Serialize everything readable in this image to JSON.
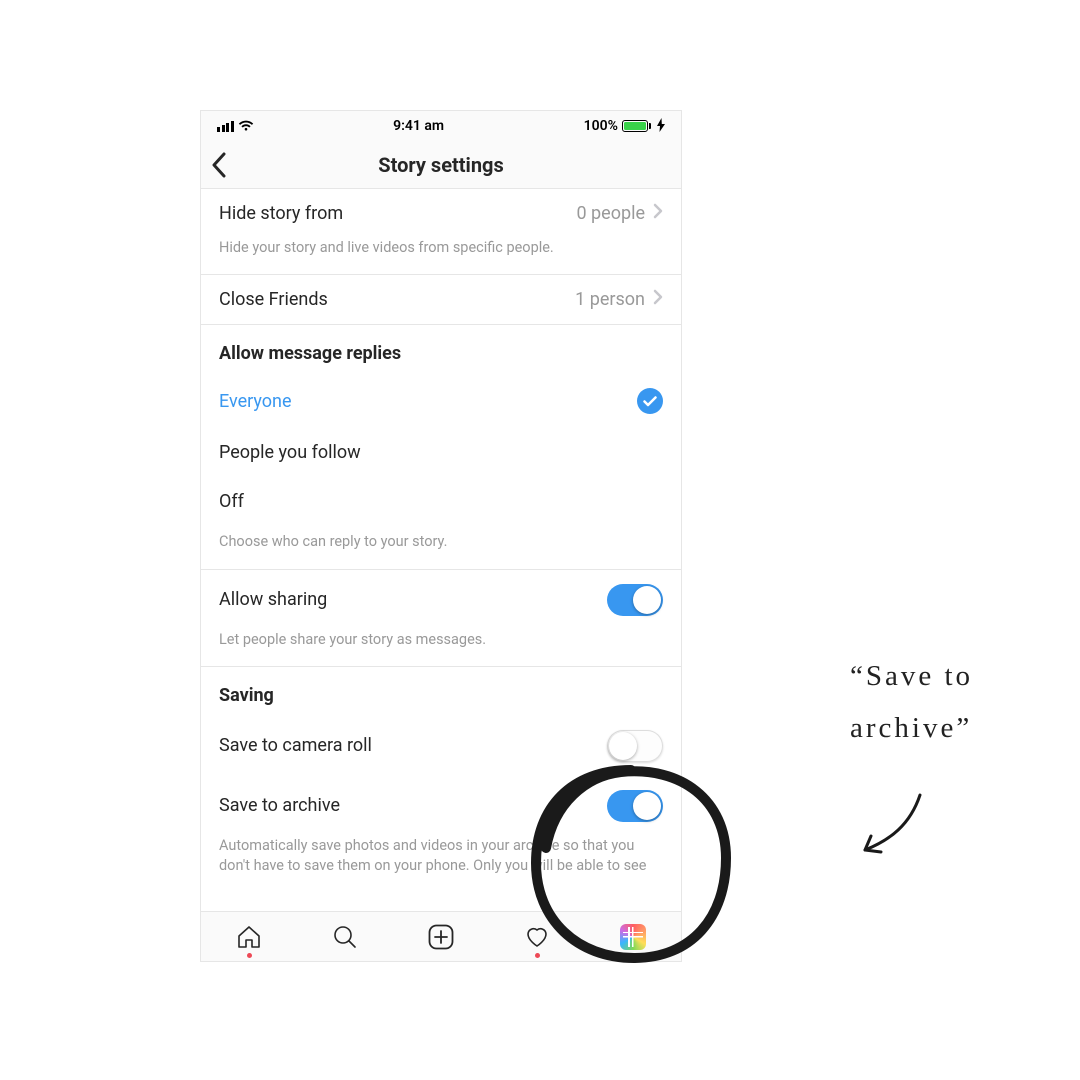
{
  "statusbar": {
    "time": "9:41 am",
    "battery_text": "100%"
  },
  "header": {
    "title": "Story settings"
  },
  "hide_story": {
    "label": "Hide story from",
    "value": "0 people",
    "helper": "Hide your story and live videos from specific people."
  },
  "close_friends": {
    "label": "Close Friends",
    "value": "1 person"
  },
  "replies": {
    "title": "Allow message replies",
    "options": {
      "everyone": "Everyone",
      "following": "People you follow",
      "off": "Off"
    },
    "helper": "Choose who can reply to your story."
  },
  "sharing": {
    "label": "Allow sharing",
    "helper": "Let people share your story as messages."
  },
  "saving": {
    "title": "Saving",
    "camera_roll": "Save to camera roll",
    "archive": "Save to archive",
    "helper": "Automatically save photos and videos in your archive so that you don't have to save them on your phone. Only you will be able to see"
  },
  "annotation": {
    "line1": "“Save to",
    "line2": "archive”"
  }
}
